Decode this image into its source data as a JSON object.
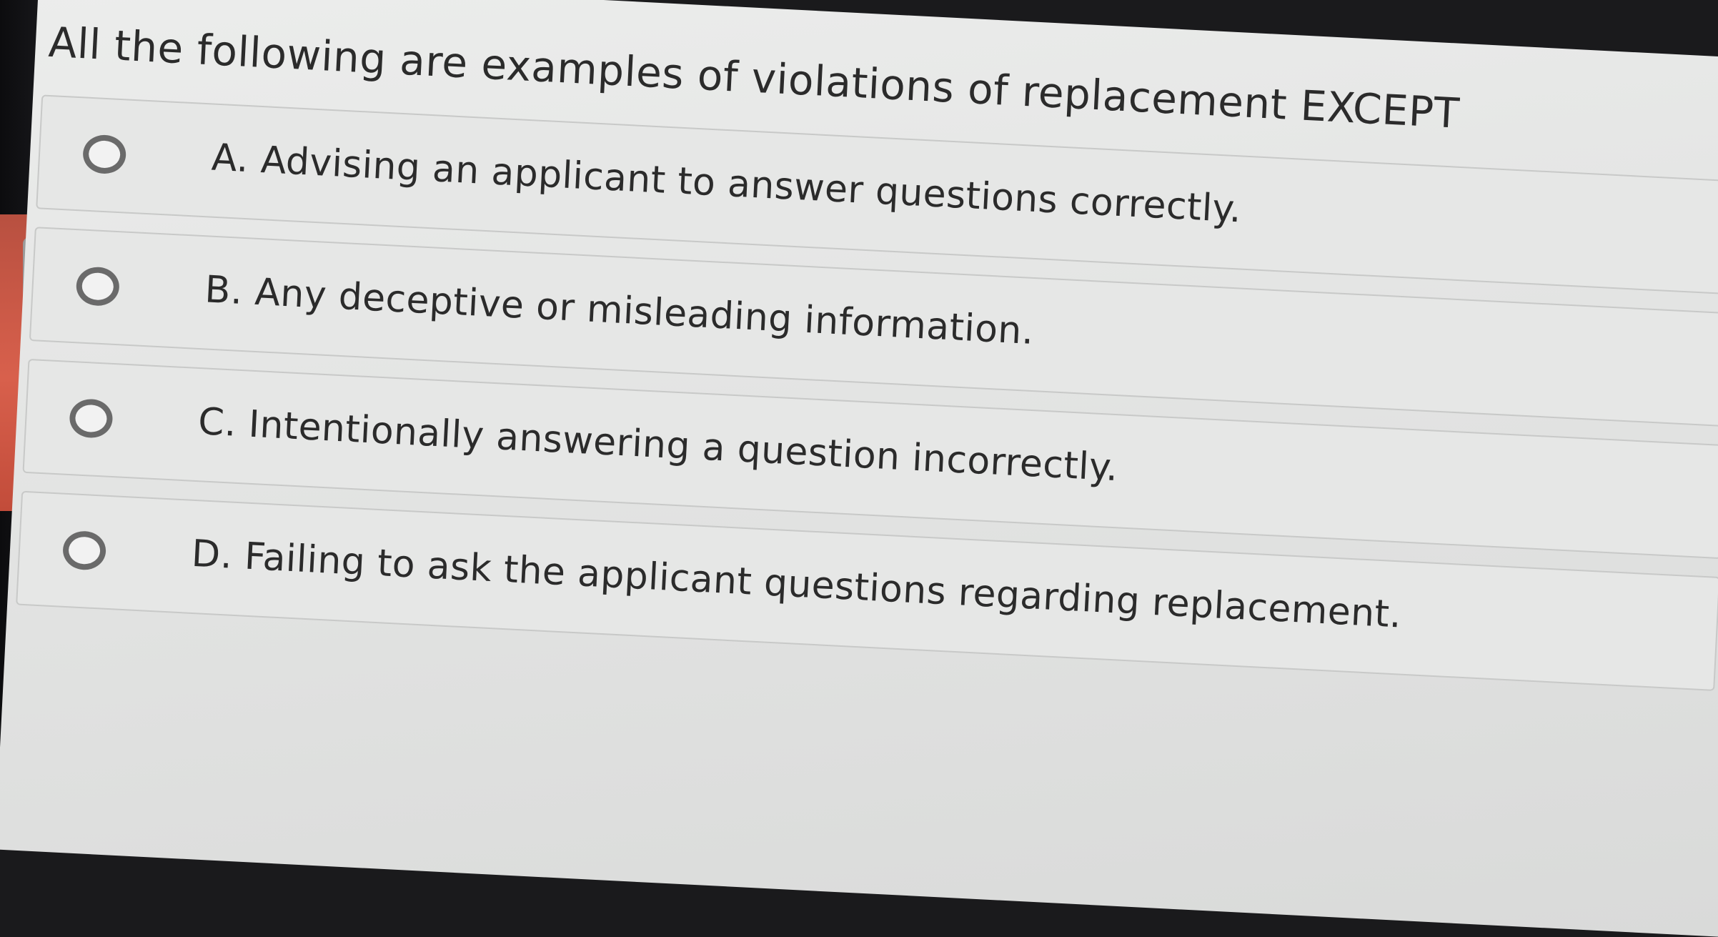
{
  "question": {
    "text": "All the following are examples of violations of replacement EXCEPT"
  },
  "options": [
    {
      "label": "A. Advising an applicant to answer questions correctly."
    },
    {
      "label": "B. Any deceptive or misleading information."
    },
    {
      "label": "C. Intentionally answering a question incorrectly."
    },
    {
      "label": "D. Failing to ask the applicant questions regarding replacement."
    }
  ],
  "colors": {
    "text": "#2b2b2b",
    "radio_border": "#6a6a6a",
    "accent": "#d8604c"
  }
}
